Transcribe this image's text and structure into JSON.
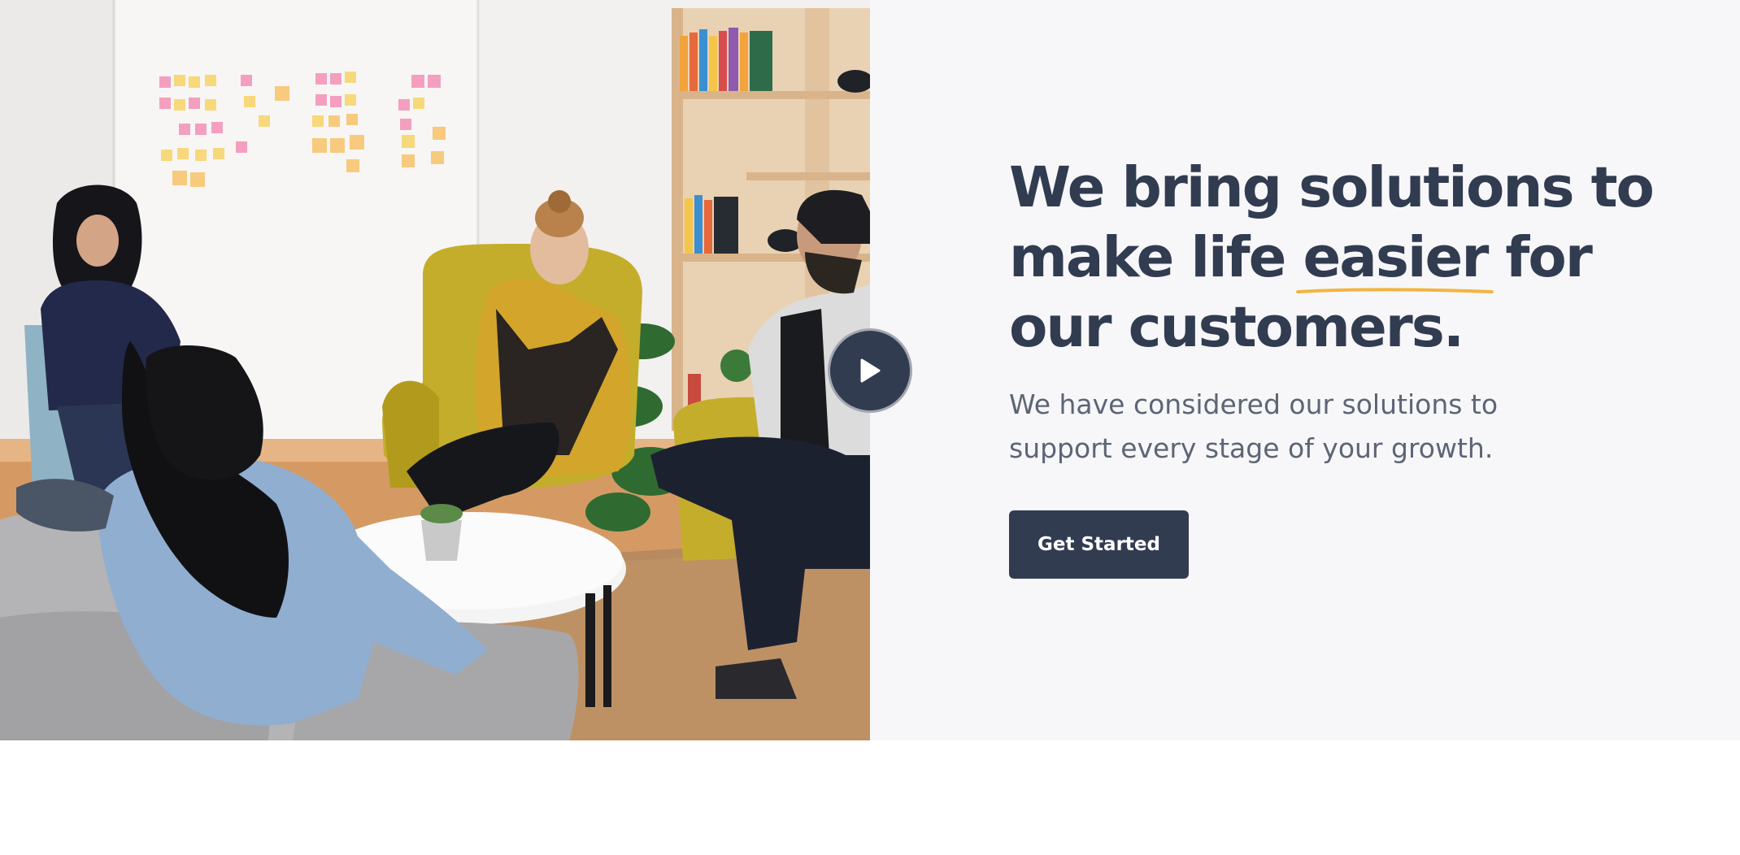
{
  "hero": {
    "headline_before": "We bring solutions to make life ",
    "headline_highlight": "easier",
    "headline_after": " for our customers.",
    "subtitle": "We have considered our solutions to support every stage of your growth.",
    "cta_label": "Get Started"
  },
  "media": {
    "image_alt": "Team of people sitting in chairs in a bright office meeting",
    "play_label": "Play video"
  },
  "icons": {
    "play": "play-icon"
  },
  "colors": {
    "primary": "#313c51",
    "accent_underline": "#f3b43f",
    "panel_background": "#f7f7f9",
    "subtitle_text": "#5d6575"
  }
}
